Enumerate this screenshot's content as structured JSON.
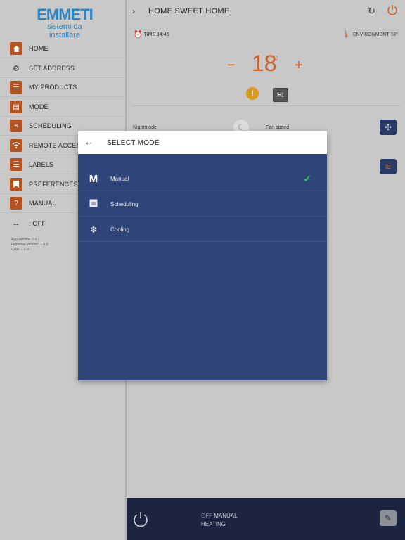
{
  "sidebar": {
    "logo": {
      "brand": "EMMETI",
      "tagline": "sistemi da installare"
    },
    "items": [
      {
        "label": "HOME",
        "icon": "home-icon"
      },
      {
        "label": "SET ADDRESS",
        "icon": "gear-icon"
      },
      {
        "label": "MY PRODUCTS",
        "icon": "list-icon"
      },
      {
        "label": "MODE",
        "icon": "document-icon"
      },
      {
        "label": "SCHEDULING",
        "icon": "sliders-icon"
      },
      {
        "label": "REMOTE ACCESS",
        "icon": "wifi-icon"
      },
      {
        "label": "LABELS",
        "icon": "list-icon"
      },
      {
        "label": "PREFERENCES",
        "icon": "bookmark-icon"
      },
      {
        "label": "MANUAL",
        "icon": "help-icon"
      },
      {
        "label": ": OFF",
        "icon": "arrows-icon"
      }
    ],
    "version": {
      "app": "App version: 2.0.1",
      "firmware": "Firmware version: 1.0.0",
      "core": "Core: 1.0.0"
    }
  },
  "header": {
    "title": "HOME SWEET HOME"
  },
  "status": {
    "time": "TIME 14:46",
    "environment": "ENVIRONMENT 18°",
    "temperature": "18",
    "unit": "°C",
    "hi_badge": "H!"
  },
  "controls": {
    "nightmode_label": "Nightmode",
    "fanspeed_label": "Fan speed"
  },
  "bottom_bar": {
    "state": "OFF",
    "mode": "MANUAL",
    "function": "HEATING"
  },
  "modal": {
    "title": "SELECT MODE",
    "options": [
      {
        "label": "Manual",
        "icon": "manual-m-icon",
        "selected": true
      },
      {
        "label": "Scheduling",
        "icon": "calendar-icon",
        "selected": false
      },
      {
        "label": "Cooling",
        "icon": "snowflake-icon",
        "selected": false
      }
    ]
  },
  "colors": {
    "accent_orange": "#c8632c",
    "modal_blue": "#2f4478",
    "bottom_bar": "#1c2540",
    "check_green": "#2ecc40"
  }
}
